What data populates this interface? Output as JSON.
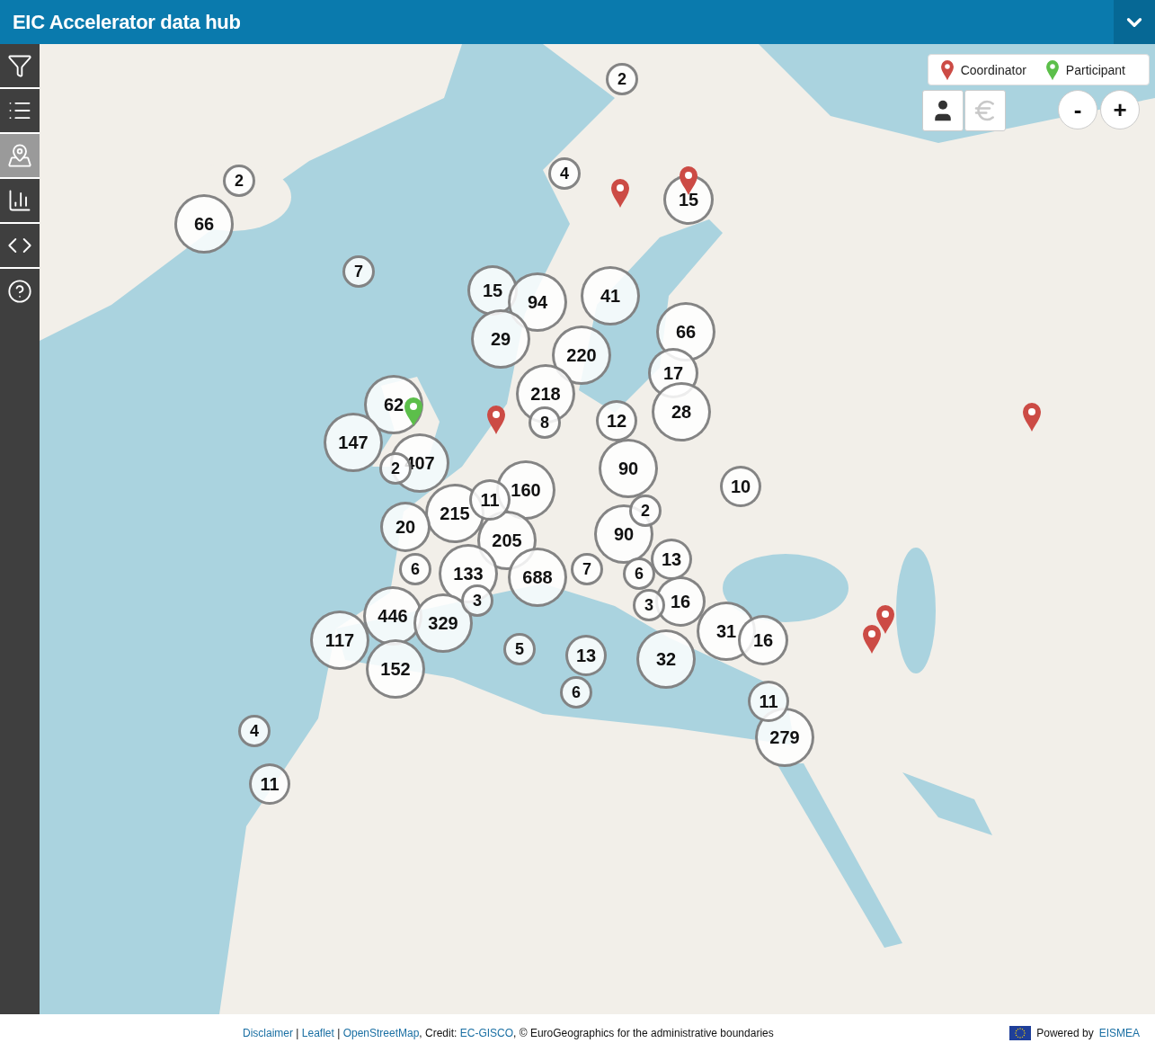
{
  "header": {
    "title": "EIC Accelerator data hub",
    "menu_expanded": false
  },
  "sidebar": {
    "items": [
      {
        "kind": "filter",
        "selected": false
      },
      {
        "kind": "list",
        "selected": false
      },
      {
        "kind": "map",
        "selected": true
      },
      {
        "kind": "chart",
        "selected": false
      },
      {
        "kind": "embed",
        "selected": false
      },
      {
        "kind": "help",
        "selected": false
      }
    ]
  },
  "legend": [
    {
      "kind": "coordinator",
      "label": "Coordinator"
    },
    {
      "kind": "participant",
      "label": "Participant"
    }
  ],
  "view_toggles": [
    {
      "kind": "person",
      "selected": true
    },
    {
      "kind": "euro",
      "selected": false
    }
  ],
  "zoom_controls": [
    "-",
    "+"
  ],
  "clusters": [
    "2",
    "4",
    "15",
    "2",
    "66",
    "7",
    "15",
    "94",
    "41",
    "66",
    "29",
    "220",
    "17",
    "218",
    "28",
    "62",
    "8",
    "12",
    "147",
    "2",
    "407",
    "90",
    "10",
    "160",
    "215",
    "11",
    "2",
    "20",
    "205",
    "90",
    "13",
    "6",
    "133",
    "688",
    "7",
    "6",
    "3",
    "3",
    "16",
    "446",
    "329",
    "117",
    "31",
    "16",
    "5",
    "13",
    "32",
    "152",
    "6",
    "11",
    "279",
    "4",
    "11"
  ],
  "pins": [
    {
      "kind": "coordinator"
    },
    {
      "kind": "coordinator"
    },
    {
      "kind": "participant"
    },
    {
      "kind": "coordinator"
    },
    {
      "kind": "coordinator"
    },
    {
      "kind": "coordinator"
    },
    {
      "kind": "coordinator"
    }
  ],
  "footer": {
    "credits": [
      {
        "text": "Disclaimer",
        "link": true
      },
      {
        "text": " | ",
        "link": false
      },
      {
        "text": "Leaflet",
        "link": true
      },
      {
        "text": " | ",
        "link": false
      },
      {
        "text": "OpenStreetMap",
        "link": true
      },
      {
        "text": ", Credit: ",
        "link": false
      },
      {
        "text": "EC-GISCO",
        "link": true
      },
      {
        "text": ", © EuroGeographics for the administrative boundaries",
        "link": false
      }
    ],
    "powered_by": "Powered by",
    "powered_link": "EISMEA"
  }
}
